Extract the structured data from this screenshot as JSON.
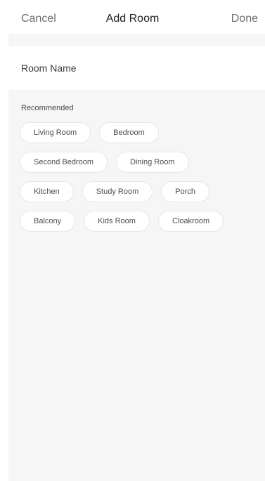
{
  "nav": {
    "cancel_label": "Cancel",
    "title": "Add Room",
    "done_label": "Done"
  },
  "room_name": {
    "placeholder": "Room Name",
    "value": ""
  },
  "recommended": {
    "label": "Recommended",
    "rows": [
      [
        "Living Room",
        "Bedroom"
      ],
      [
        "Second Bedroom",
        "Dining Room"
      ],
      [
        "Kitchen",
        "Study Room",
        "Porch"
      ],
      [
        "Balcony",
        "Kids Room",
        "Cloakroom"
      ]
    ]
  }
}
